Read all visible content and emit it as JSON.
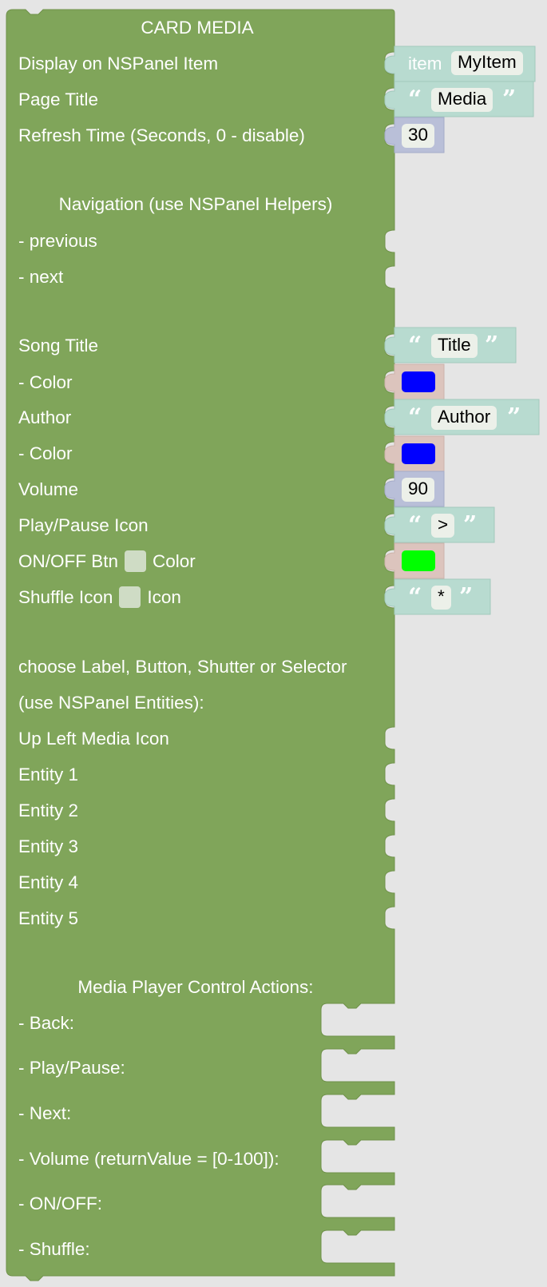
{
  "block": {
    "title": "CARD MEDIA",
    "color": "#80a55a",
    "rows": {
      "display_item": "Display on NSPanel Item",
      "page_title": "Page Title",
      "refresh_time": "Refresh Time (Seconds, 0 - disable)",
      "navigation_header": "Navigation (use NSPanel Helpers)",
      "previous": "- previous",
      "next": "- next",
      "song_title": "Song Title",
      "song_color": "- Color",
      "author": "Author",
      "author_color": "- Color",
      "volume": "Volume",
      "play_pause_icon": "Play/Pause Icon",
      "onoff_btn": "ON/OFF Btn",
      "onoff_color": "Color",
      "shuffle_icon": "Shuffle Icon",
      "shuffle_icon2": "Icon",
      "entities_header_1": "choose Label, Button, Shutter or Selector",
      "entities_header_2": "(use NSPanel Entities):",
      "up_left_media_icon": "Up Left Media Icon",
      "entity_1": "Entity 1",
      "entity_2": "Entity 2",
      "entity_3": "Entity 3",
      "entity_4": "Entity 4",
      "entity_5": "Entity 5",
      "actions_header": "Media Player Control Actions:",
      "back": "- Back:",
      "play_pause": "- Play/Pause:",
      "next_action": "- Next:",
      "volume_action": "- Volume (returnValue = [0-100]):",
      "onoff_action": "- ON/OFF:",
      "shuffle_action": "- Shuffle:"
    }
  },
  "inputs": {
    "item": {
      "prefix": "item",
      "value": "MyItem",
      "color": "#b8dbd0"
    },
    "page_title": {
      "value": "Media",
      "color": "#b8dbd0"
    },
    "refresh_time": {
      "value": "30",
      "color": "#b9bfd8"
    },
    "song_title": {
      "value": "Title",
      "color": "#b8dbd0"
    },
    "song_color": {
      "swatch": "#0000ff",
      "color": "#dcc4bd"
    },
    "author": {
      "value": "Author",
      "color": "#b8dbd0"
    },
    "author_color": {
      "swatch": "#0000ff",
      "color": "#dcc4bd"
    },
    "volume": {
      "value": "90",
      "color": "#b9bfd8"
    },
    "play_pause_icon": {
      "value": ">",
      "color": "#b8dbd0"
    },
    "onoff_color": {
      "swatch": "#00ff00",
      "color": "#dcc4bd"
    },
    "shuffle_icon": {
      "value": "*",
      "color": "#b8dbd0"
    }
  },
  "quotes": {
    "open": "“",
    "close": "”"
  }
}
